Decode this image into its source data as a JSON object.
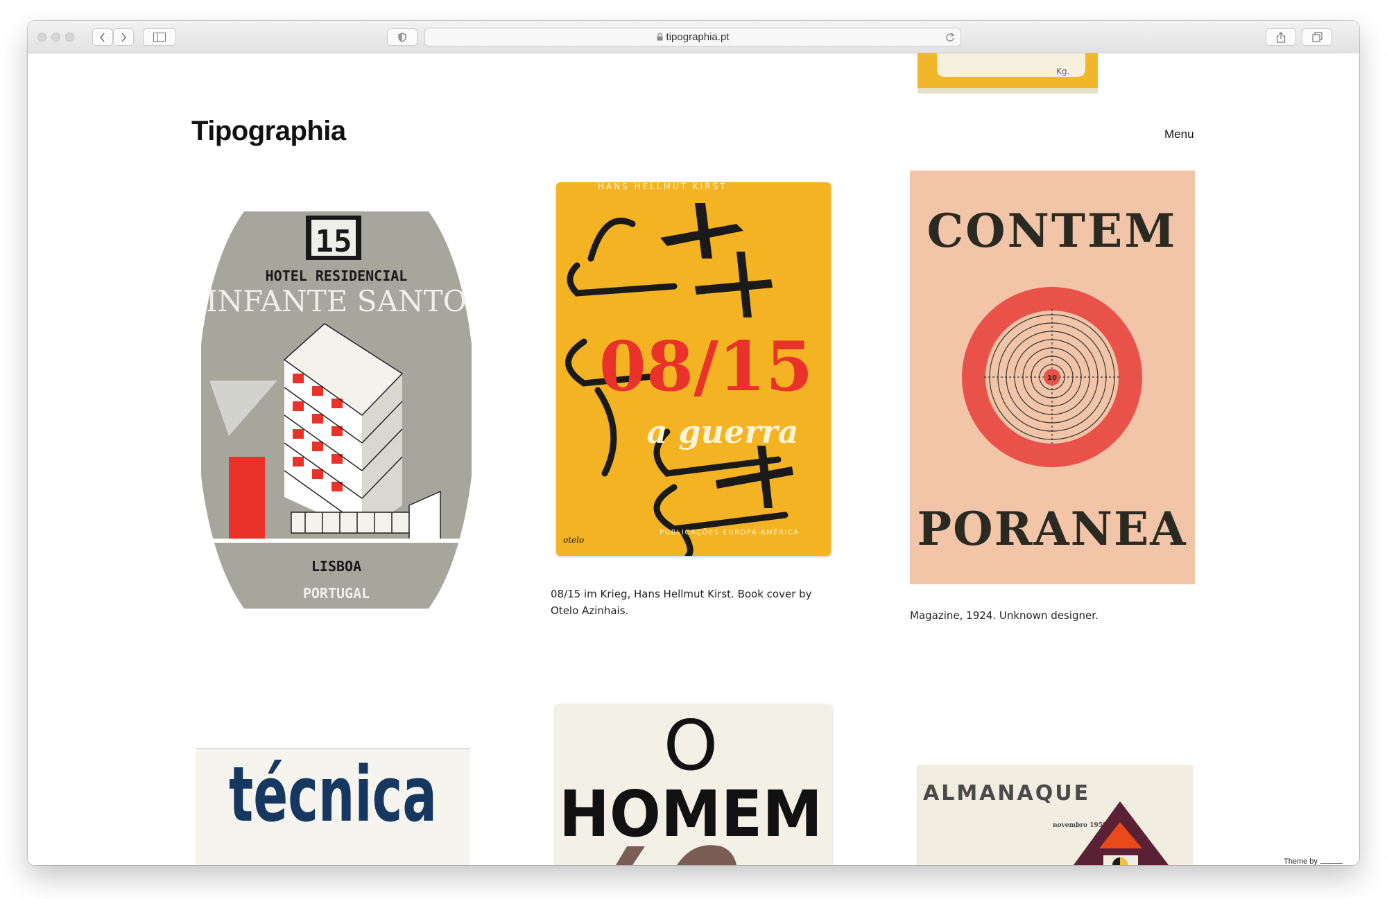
{
  "browser": {
    "url": "tipographia.pt",
    "lock_icon": "lock-icon"
  },
  "site": {
    "title": "Tipographia",
    "menu_label": "Menu"
  },
  "gallery": {
    "hotel_label": {
      "number": "15",
      "line1": "HOTEL RESIDENCIAL",
      "line2": "INFANTE SANTO",
      "city": "LISBOA",
      "country": "PORTUGAL"
    },
    "book_cover": {
      "author": "HANS HELLMUT KIRST",
      "title": "08/15",
      "subtitle": "a guerra",
      "publisher": "PUBLICAÇÕES EUROPA-AMÉRICA",
      "signature": "otelo",
      "caption_line1": "08/15 im Krieg, Hans Hellmut Kirst. Book cover by",
      "caption_line2": "Otelo Azinhais."
    },
    "magazine": {
      "line1": "CONTEM",
      "line2": "PORANEA",
      "target_number": "10",
      "caption": "Magazine, 1924. Unknown designer."
    },
    "tecnica": {
      "title": "técnica"
    },
    "homem": {
      "line1": "O",
      "line2": "HOMEM"
    },
    "almanaque": {
      "title": "ALMANAQUE",
      "date": "novembro 1959"
    },
    "top_partial": {
      "text": "Kg."
    }
  },
  "footer": {
    "theme_label": "Theme by"
  },
  "colors": {
    "red": "#e8322a",
    "yellow": "#f4b322",
    "navy": "#16375f",
    "grey_label": "#a7a69d"
  }
}
